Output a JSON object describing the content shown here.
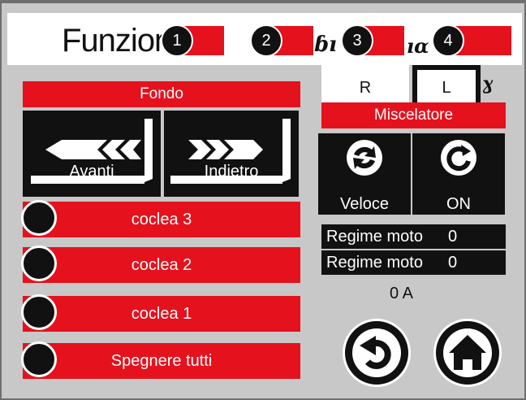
{
  "header": {
    "title": "Funzione",
    "tabs": [
      {
        "number": "1"
      },
      {
        "number": "2"
      },
      {
        "number": "3"
      },
      {
        "number": "4"
      }
    ]
  },
  "side_selector": {
    "left_label": "R",
    "right_label": "L",
    "selected": "L"
  },
  "fondo": {
    "title": "Fondo",
    "forward_label": "Avanti",
    "reverse_label": "Indietro"
  },
  "coclee": [
    {
      "label": "coclea 3"
    },
    {
      "label": "coclea 2"
    },
    {
      "label": "coclea 1"
    },
    {
      "label": "Spegnere tutti"
    }
  ],
  "miscelatore": {
    "title": "Miscelatore",
    "speed_label": "Veloce",
    "power_label": "ON",
    "regime_rows": [
      {
        "label": "Regime moto",
        "value": "0"
      },
      {
        "label": "Regime moto",
        "value": "0"
      }
    ],
    "current": "0 A"
  },
  "colors": {
    "red": "#e5111d",
    "black": "#111111",
    "panel": "#c8c8c8",
    "frame": "#6e6e6e"
  },
  "icons": [
    "number-badge",
    "arrow-left-icon",
    "arrow-right-icon",
    "recycle-icon",
    "refresh-icon",
    "back-icon",
    "home-icon"
  ]
}
